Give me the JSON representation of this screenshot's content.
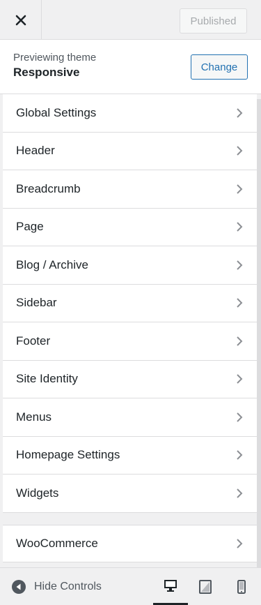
{
  "topbar": {
    "close_icon": "close-icon",
    "publish_label": "Published"
  },
  "theme": {
    "previewing_label": "Previewing theme",
    "name": "Responsive",
    "change_label": "Change"
  },
  "sections": [
    {
      "label": "Global Settings"
    },
    {
      "label": "Header"
    },
    {
      "label": "Breadcrumb"
    },
    {
      "label": "Page"
    },
    {
      "label": "Blog / Archive"
    },
    {
      "label": "Sidebar"
    },
    {
      "label": "Footer"
    },
    {
      "label": "Site Identity"
    },
    {
      "label": "Menus"
    },
    {
      "label": "Homepage Settings"
    },
    {
      "label": "Widgets"
    }
  ],
  "extra_sections": [
    {
      "label": "WooCommerce"
    }
  ],
  "footer": {
    "hide_controls_label": "Hide Controls",
    "devices": [
      "desktop-icon",
      "tablet-icon",
      "mobile-icon"
    ],
    "active_device": "desktop"
  },
  "colors": {
    "accent": "#2271b1",
    "text": "#1d2327",
    "muted": "#50575e",
    "border": "#dcdcde",
    "background": "#f0f0f1"
  }
}
